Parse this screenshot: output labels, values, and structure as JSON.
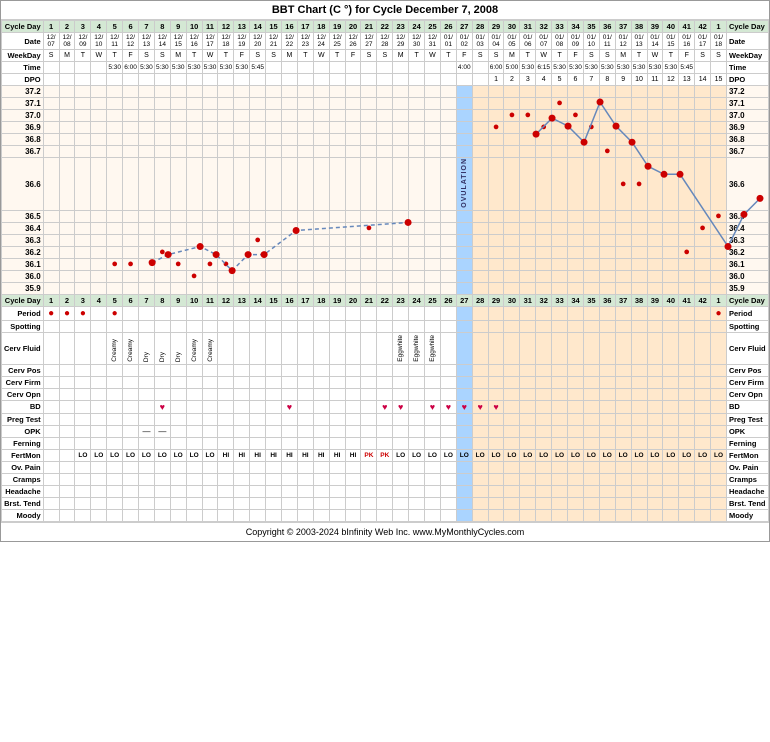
{
  "title": "BBT Chart (C °) for Cycle December 7, 2008",
  "copyright": "Copyright © 2003-2024 bInfinity Web Inc.   www.MyMonthlyCycles.com",
  "cycle_days": [
    "1",
    "2",
    "3",
    "4",
    "5",
    "6",
    "7",
    "8",
    "9",
    "10",
    "11",
    "12",
    "13",
    "14",
    "15",
    "16",
    "17",
    "18",
    "19",
    "20",
    "21",
    "22",
    "23",
    "24",
    "25",
    "26",
    "27",
    "28",
    "29",
    "30",
    "31",
    "32",
    "33",
    "34",
    "35",
    "36",
    "37",
    "38",
    "39",
    "40",
    "41",
    "42",
    "1"
  ],
  "dates": [
    "12/07",
    "12/08",
    "12/09",
    "12/10",
    "12/11",
    "12/12",
    "12/13",
    "12/14",
    "12/15",
    "12/16",
    "12/17",
    "12/18",
    "12/19",
    "12/20",
    "12/21",
    "12/22",
    "12/23",
    "12/24",
    "12/25",
    "12/26",
    "12/27",
    "12/28",
    "12/29",
    "12/30",
    "12/31",
    "01/01",
    "01/02",
    "01/03",
    "01/04",
    "01/05",
    "01/06",
    "01/07",
    "01/08",
    "01/09",
    "01/10",
    "01/11",
    "01/12",
    "01/13",
    "01/14",
    "01/15",
    "01/16",
    "01/17",
    "01/18"
  ],
  "weekdays": [
    "S",
    "M",
    "T",
    "W",
    "T",
    "F",
    "S",
    "S",
    "M",
    "T",
    "W",
    "T",
    "F",
    "S",
    "S",
    "M",
    "T",
    "W",
    "T",
    "F",
    "S",
    "S",
    "M",
    "T",
    "W",
    "T",
    "F",
    "S",
    "S",
    "M",
    "T",
    "W",
    "T",
    "F",
    "S",
    "S",
    "M",
    "T",
    "W",
    "T",
    "F",
    "S",
    "S"
  ],
  "times": [
    "",
    "",
    "",
    "",
    "5:30",
    "6:00",
    "5:30",
    "5:30",
    "5:30",
    "5:30",
    "5:30",
    "5:30",
    "5:30",
    "5:45",
    "",
    "",
    "",
    "",
    "",
    "",
    "",
    "",
    "",
    "",
    "",
    "",
    "",
    "4:00",
    "",
    "",
    "",
    "",
    "",
    "",
    "6:00",
    "5:00",
    "5:30",
    "6:15",
    "5:30",
    "5:30",
    "5:30",
    "5:30",
    "5:30",
    "5:30",
    "5:30",
    "5:45"
  ],
  "dpo": [
    "",
    "",
    "",
    "",
    "",
    "",
    "",
    "",
    "",
    "",
    "",
    "",
    "",
    "",
    "",
    "",
    "",
    "",
    "",
    "",
    "",
    "",
    "",
    "",
    "",
    "",
    "",
    "",
    "1",
    "2",
    "3",
    "4",
    "5",
    "6",
    "7",
    "8",
    "9",
    "10",
    "11",
    "12",
    "13",
    "14",
    "15"
  ],
  "labels": {
    "cycle_day": "Cycle Day",
    "date": "Date",
    "weekday": "WeekDay",
    "time": "Time",
    "dpo": "DPO",
    "period": "Period",
    "spotting": "Spotting",
    "cerv_fluid": "Cerv Fluid",
    "cerv_pos": "Cerv Pos",
    "cerv_firm": "Cerv Firm",
    "cerv_opn": "Cerv Opn",
    "bd": "BD",
    "preg_test": "Preg Test",
    "opk": "OPK",
    "ferning": "Ferning",
    "fertmon": "FertMon",
    "ov_pain": "Ov. Pain",
    "cramps": "Cramps",
    "headache": "Headache",
    "brst_tend": "Brst. Tend",
    "moody": "Moody"
  },
  "temp_labels": [
    "37.2",
    "37.1",
    "37.0",
    "36.9",
    "36.8",
    "36.7",
    "36.6",
    "36.5",
    "36.4",
    "36.3",
    "36.2",
    "36.1",
    "36.0",
    "35.9"
  ],
  "ovulation_day_index": 26,
  "temperatures": {
    "4": 36.1,
    "5": 36.15,
    "6": 36.2,
    "7": 36.2,
    "8": 36.1,
    "9": 36.05,
    "10": 36.15,
    "11": 36.15,
    "13": 36.3,
    "20": 36.35,
    "27": 36.9,
    "28": 37.0,
    "29": 36.95,
    "30": 36.85,
    "31": 36.85,
    "32": 37.1,
    "33": 36.95,
    "34": 36.85,
    "35": 36.75,
    "36": 36.65,
    "37": 36.65,
    "40": 36.2,
    "41": 36.4,
    "42": 36.5
  }
}
